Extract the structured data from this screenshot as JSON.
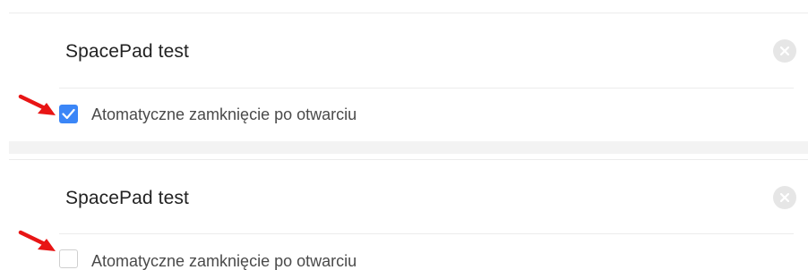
{
  "cards": [
    {
      "title": "SpacePad test",
      "option_label": "Atomatyczne zamknięcie po otwarciu",
      "option_checked": true,
      "close_icon": "close-circle-icon",
      "pointer_icon": "red-arrow-icon"
    },
    {
      "title": "SpacePad test",
      "option_label": "Atomatyczne zamknięcie po otwarciu",
      "option_checked": false,
      "close_icon": "close-circle-icon",
      "pointer_icon": "red-arrow-icon"
    }
  ],
  "colors": {
    "checkbox_checked": "#3b86f7",
    "arrow": "#e81515",
    "close_button": "#e6e6e6"
  }
}
